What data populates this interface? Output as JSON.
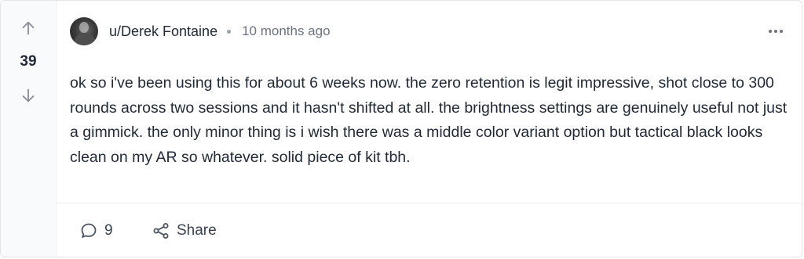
{
  "post": {
    "votes": "39",
    "author": "u/Derek Fontaine",
    "timestamp": "10 months ago",
    "body": "ok so i've been using this for about 6 weeks now. the zero retention is legit impressive, shot close to 300 rounds across two sessions and it hasn't shifted at all. the brightness settings are genuinely useful not just a gimmick. the only minor thing is i wish there was a middle color variant option but tactical black looks clean on my AR so whatever. solid piece of kit tbh.",
    "comments_count": "9",
    "share_label": "Share"
  },
  "icons": {
    "upvote": "arrow-up-icon",
    "downvote": "arrow-down-icon",
    "more": "more-options-icon",
    "comment": "comment-bubble-icon",
    "share": "share-icon"
  },
  "colors": {
    "text": "#1f2937",
    "muted": "#6b7280",
    "border": "#e4e4e7",
    "vote_column_bg": "#f9fafb"
  }
}
